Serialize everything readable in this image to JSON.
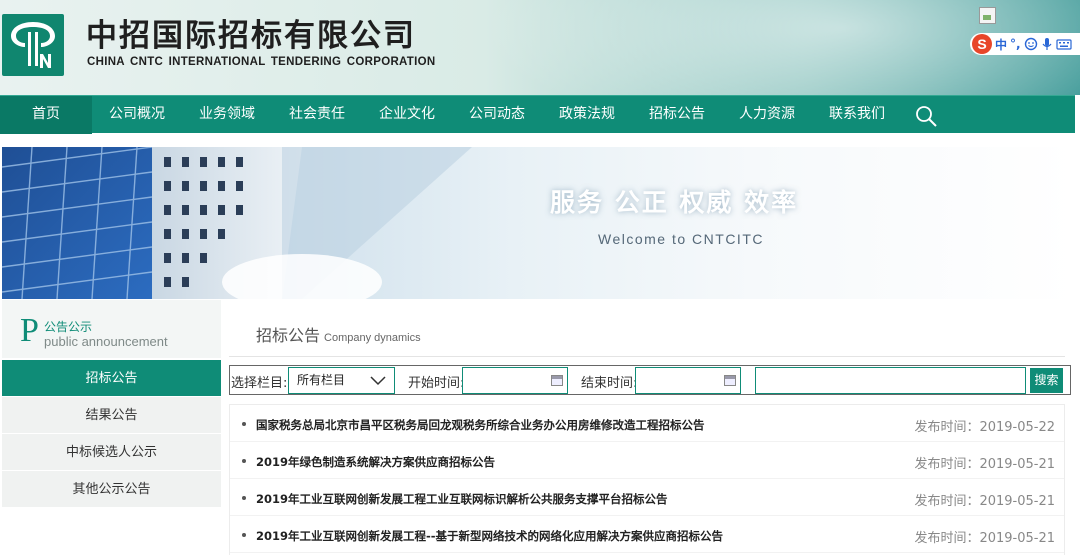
{
  "header": {
    "brand_cn": "中招国际招标有限公司",
    "brand_en": "CHINA CNTC INTERNATIONAL  TENDERING  CORPORATION",
    "ime": {
      "logo": "S",
      "lang": "中",
      "punct": "°,",
      "items": [
        "smile-icon",
        "mic-icon",
        "keyboard-icon"
      ]
    }
  },
  "nav": {
    "items": [
      "首页",
      "公司概况",
      "业务领域",
      "社会责任",
      "企业文化",
      "公司动态",
      "政策法规",
      "招标公告",
      "人力资源",
      "联系我们"
    ],
    "search_icon": "search-icon"
  },
  "banner": {
    "title": "服务  公正  权威  效率",
    "subtitle": "Welcome to CNTCITC"
  },
  "sidebar": {
    "letter": "P",
    "title_cn": "公告公示",
    "title_en": "public announcement",
    "items": [
      {
        "label": "招标公告",
        "active": true
      },
      {
        "label": "结果公告",
        "active": false
      },
      {
        "label": "中标候选人公示",
        "active": false
      },
      {
        "label": "其他公示公告",
        "active": false
      }
    ]
  },
  "main": {
    "title": "招标公告",
    "title_en": "Company dynamics",
    "filter": {
      "column_label": "选择栏目:",
      "column_value": "所有栏目",
      "start_label": "开始时间:",
      "end_label": "结束时间:",
      "search_button": "搜索"
    },
    "list": [
      {
        "title": "国家税务总局北京市昌平区税务局回龙观税务所综合业务办公用房维修改造工程招标公告",
        "date": "发布时间：2019-05-22"
      },
      {
        "title": "2019年绿色制造系统解决方案供应商招标公告",
        "date": "发布时间：2019-05-21"
      },
      {
        "title": "2019年工业互联网创新发展工程工业互联网标识解析公共服务支撑平台招标公告",
        "date": "发布时间：2019-05-21"
      },
      {
        "title": "2019年工业互联网创新发展工程--基于新型网络技术的网络化应用解决方案供应商招标公告",
        "date": "发布时间：2019-05-21"
      }
    ]
  },
  "colors": {
    "primary": "#0f8c77",
    "nav_active": "#0a7965",
    "ime_logo": "#e8462a"
  }
}
